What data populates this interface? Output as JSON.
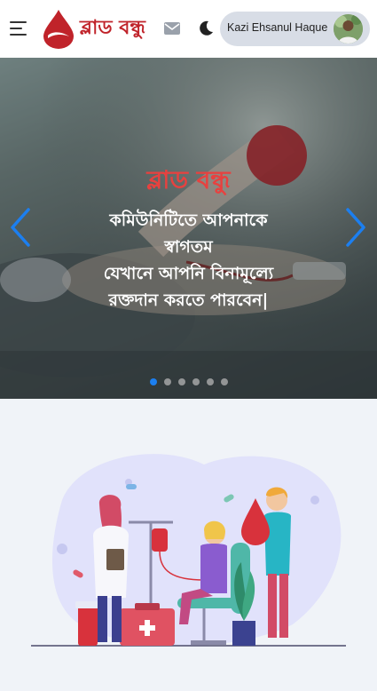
{
  "header": {
    "brand": "ব্লাড বন্ধু",
    "icons": [
      "menu-icon",
      "mail-icon",
      "moon-icon"
    ],
    "user_name": "Kazi Ehsanul Haque"
  },
  "hero": {
    "title": "ব্লাড বন্ধু",
    "lines": [
      "কমিউনিটিতে আপনাকে",
      "স্বাগতম",
      "যেখানে আপনি বিনামূল্যে",
      "রক্তদান করতে পারবেন|"
    ],
    "slide_count": 6,
    "active_slide": 1
  },
  "colors": {
    "brand_red": "#c0232a",
    "hero_title": "#e8413f",
    "accent_blue": "#1c7ff0",
    "page_bg": "#f0f3f8"
  }
}
